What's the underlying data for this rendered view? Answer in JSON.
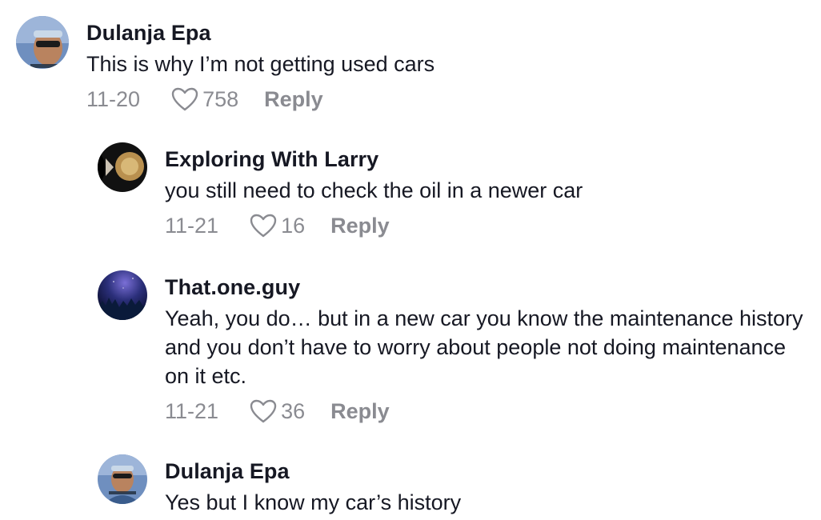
{
  "comments": [
    {
      "username": "Dulanja Epa",
      "text": "This is why I’m not getting used cars",
      "date": "11-20",
      "likes": "758",
      "reply_label": "Reply"
    },
    {
      "username": "Exploring With Larry",
      "text": "you still need to check the oil in a newer car",
      "date": "11-21",
      "likes": "16",
      "reply_label": "Reply"
    },
    {
      "username": "That.one.guy",
      "text": "Yeah, you do… but in a new car you know the maintenance history and you don’t have to worry about people not doing maintenance on it etc.",
      "date": "11-21",
      "likes": "36",
      "reply_label": "Reply"
    },
    {
      "username": "Dulanja Epa",
      "text": "Yes but I know my car’s history"
    }
  ],
  "colors": {
    "text": "#161823",
    "muted": "#8a8b91"
  }
}
